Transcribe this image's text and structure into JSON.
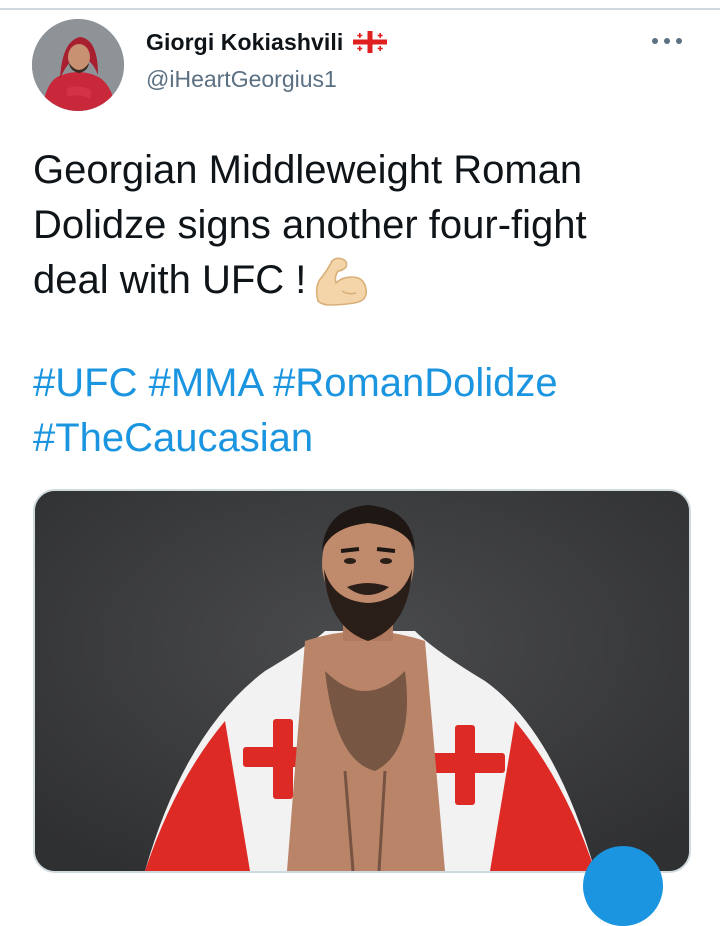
{
  "tweet": {
    "author": {
      "display_name": "Giorgi Kokiashvili",
      "handle": "@iHeartGeorgius1",
      "flag_icon": "georgia-flag-icon",
      "avatar_icon": "avatar-man-red-hood"
    },
    "text_lines": [
      "Georgian Middleweight Roman",
      "Dolidze signs another four-fight",
      "deal with UFC !"
    ],
    "emoji": "flexed-biceps-icon",
    "hashtags": [
      "#UFC",
      "#MMA",
      "#RomanDolidze",
      "#TheCaucasian"
    ],
    "media": {
      "subject": "bearded fighter wrapped in Georgian flag"
    }
  },
  "colors": {
    "text": "#0f1419",
    "secondary": "#5b7083",
    "link": "#1b95e0",
    "divider": "#cfd9de",
    "media_background": "#3b3c3e",
    "flag_red": "#e0201e"
  }
}
